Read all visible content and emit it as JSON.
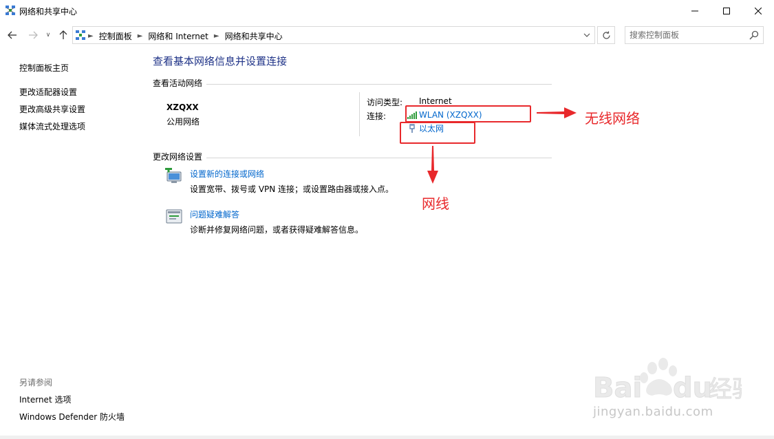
{
  "window": {
    "title": "网络和共享中心",
    "minimize_icon": "minimize-icon",
    "maximize_icon": "maximize-icon",
    "close_icon": "close-icon"
  },
  "navigation": {
    "breadcrumbs": [
      "控制面板",
      "网络和 Internet",
      "网络和共享中心"
    ],
    "search_placeholder": "搜索控制面板"
  },
  "sidebar": {
    "home": "控制面板主页",
    "links": [
      "更改适配器设置",
      "更改高级共享设置",
      "媒体流式处理选项"
    ],
    "see_also_heading": "另请参阅",
    "see_also": [
      "Internet 选项",
      "Windows Defender 防火墙"
    ]
  },
  "main": {
    "title": "查看基本网络信息并设置连接",
    "active_networks_label": "查看活动网络",
    "network": {
      "name": "XZQXX",
      "type": "公用网络",
      "access_type_label": "访问类型:",
      "access_type_value": "Internet",
      "connections_label": "连接:",
      "connections": [
        "WLAN (XZQXX)",
        "以太网"
      ]
    },
    "change_settings_label": "更改网络设置",
    "tasks": [
      {
        "link": "设置新的连接或网络",
        "description": "设置宽带、拨号或 VPN 连接；或设置路由器或接入点。"
      },
      {
        "link": "问题疑难解答",
        "description": "诊断并修复网络问题，或者获得疑难解答信息。"
      }
    ]
  },
  "annotations": {
    "wireless": "无线网络",
    "wired": "网线",
    "color": "#e8282b"
  },
  "watermark": {
    "text": "jingyan.baidu.com"
  },
  "colors": {
    "title_blue": "#1e3287",
    "link_blue": "#0066cc"
  }
}
